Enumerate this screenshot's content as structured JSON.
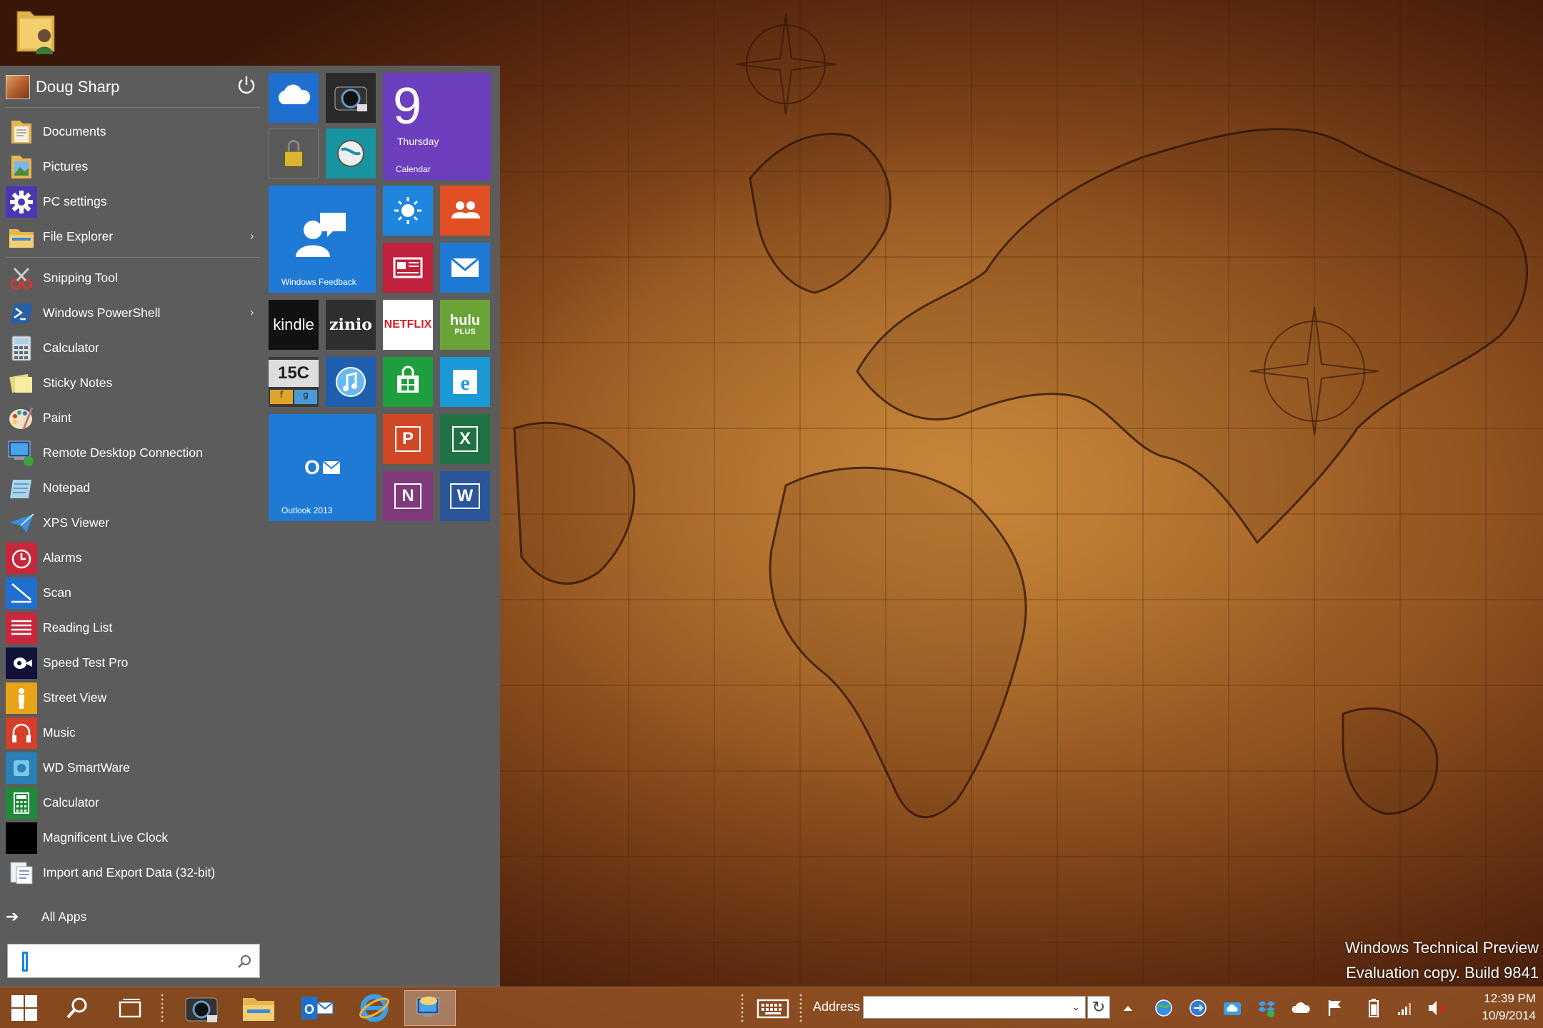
{
  "desktop": {
    "icon_name": "folder-user-icon",
    "watermark_line1": "Windows Technical Preview",
    "watermark_line2": "Evaluation copy. Build 9841"
  },
  "start_menu": {
    "user_name": "Doug Sharp",
    "places": [
      {
        "label": "Documents",
        "icon": "documents-folder-icon"
      },
      {
        "label": "Pictures",
        "icon": "pictures-folder-icon"
      },
      {
        "label": "PC settings",
        "icon": "gear-icon"
      },
      {
        "label": "File Explorer",
        "icon": "file-explorer-icon",
        "chevron": "›"
      }
    ],
    "apps": [
      {
        "label": "Snipping Tool",
        "icon": "snipping-tool-icon"
      },
      {
        "label": "Windows PowerShell",
        "icon": "powershell-icon",
        "chevron": "›"
      },
      {
        "label": "Calculator",
        "icon": "calculator-icon"
      },
      {
        "label": "Sticky Notes",
        "icon": "sticky-notes-icon"
      },
      {
        "label": "Paint",
        "icon": "paint-icon"
      },
      {
        "label": "Remote Desktop Connection",
        "icon": "remote-desktop-icon"
      },
      {
        "label": "Notepad",
        "icon": "notepad-icon"
      },
      {
        "label": "XPS Viewer",
        "icon": "xps-viewer-icon"
      },
      {
        "label": "Alarms",
        "icon": "alarms-icon"
      },
      {
        "label": "Scan",
        "icon": "scan-icon"
      },
      {
        "label": "Reading List",
        "icon": "reading-list-icon"
      },
      {
        "label": "Speed Test Pro",
        "icon": "speed-test-icon"
      },
      {
        "label": "Street View",
        "icon": "street-view-icon"
      },
      {
        "label": "Music",
        "icon": "music-icon"
      },
      {
        "label": "WD SmartWare",
        "icon": "wd-smartware-icon"
      },
      {
        "label": "Calculator",
        "icon": "calculator-metro-icon"
      },
      {
        "label": "Magnificent Live Clock",
        "icon": "live-clock-icon"
      },
      {
        "label": "Import and Export Data (32-bit)",
        "icon": "import-export-icon"
      }
    ],
    "all_apps_label": "All Apps",
    "search_placeholder": ""
  },
  "tiles": {
    "calendar_day": "9",
    "calendar_weekday": "Thursday",
    "calendar_label": "Calendar",
    "feedback_label": "Windows Feedback",
    "outlook_label": "Outlook 2013",
    "kindle": "kindle",
    "zinio": "zinio",
    "netflix": "NETFLIX",
    "hulu": "hulu",
    "hulu_sub": "PLUS",
    "calc15c": "15C",
    "calc15c_f": "f",
    "calc15c_g": "g",
    "ppt": "P",
    "xls": "X",
    "one": "N",
    "word": "W",
    "outlook_letter": "O"
  },
  "taskbar": {
    "address_label": "Address",
    "address_value": "",
    "clock_time": "12:39 PM",
    "clock_date": "10/9/2014"
  },
  "colors": {
    "start_bg": "#5c5c5c",
    "tile_blue": "#1f7ad6",
    "tile_purple": "#6b3fbd",
    "tile_red": "#d74630",
    "tile_green": "#1e9e3c"
  }
}
